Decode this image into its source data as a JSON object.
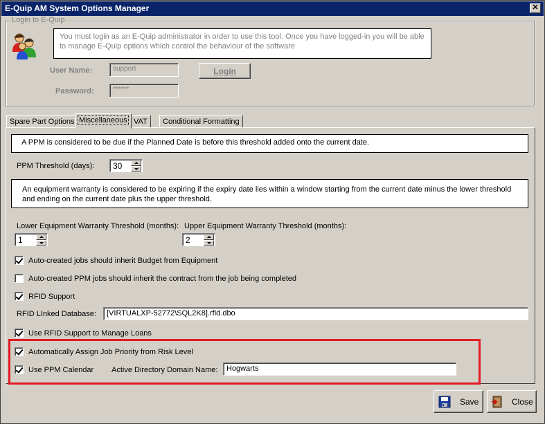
{
  "window": {
    "title": "E-Quip AM System Options Manager",
    "close_label": "✕"
  },
  "login": {
    "group_title": "Login to E-Quip",
    "message": "You must login as an E-Quip administrator in order to use this tool. Once you have logged-in you will be able to manage E-Quip options which control the behaviour of the software",
    "username_label": "User Name:",
    "username_value": "support",
    "password_label": "Password:",
    "password_value": "******",
    "login_button": "Login"
  },
  "tabs": [
    {
      "label": "Spare Part Options",
      "active": false
    },
    {
      "label": "Miscellaneous",
      "active": true
    },
    {
      "label": "VAT",
      "active": false
    },
    {
      "label": "Conditional Formatting",
      "active": false
    }
  ],
  "misc": {
    "ppm_info": "A PPM is considered to be due if the Planned Date is before this threshold added onto the current date.",
    "ppm_threshold_label": "PPM Threshold (days):",
    "ppm_threshold_value": "30",
    "warranty_info": "An equipment warranty is considered to be expiring if the expiry date lies within a window starting from the current date minus the lower threshold and ending on the current date plus the upper threshold.",
    "lower_warranty_label": "Lower Equipment Warranty Threshold (months):",
    "lower_warranty_value": "1",
    "upper_warranty_label": "Upper Equipment Warranty Threshold (months):",
    "upper_warranty_value": "2",
    "chk_budget": {
      "label": "Auto-created jobs should inherit Budget from Equipment",
      "checked": true
    },
    "chk_contract": {
      "label": "Auto-created PPM jobs should inherit the contract from the job being completed",
      "checked": false
    },
    "chk_rfid": {
      "label": "RFID Support",
      "checked": true
    },
    "rfid_db_label": "RFID LInked Database:",
    "rfid_db_value": "[VIRTUALXP-52772\\SQL2K8].rfid.dbo",
    "chk_rfid_loans": {
      "label": "Use RFID Support to Manage Loans",
      "checked": true
    },
    "chk_priority": {
      "label": "Automatically Assign Job Priority from Risk Level",
      "checked": true
    },
    "chk_ppm_calendar": {
      "label": "Use PPM Calendar",
      "checked": true
    },
    "ad_domain_label": "Active Directory Domain Name:",
    "ad_domain_value": "Hogwarts"
  },
  "buttons": {
    "save": "Save",
    "close": "Close"
  },
  "colors": {
    "titlebar": "#0a246a",
    "highlight": "#e21b23",
    "face": "#d4d0c8"
  },
  "icons": {
    "users": "users-icon",
    "save": "floppy-disk-icon",
    "close": "exit-door-icon"
  }
}
